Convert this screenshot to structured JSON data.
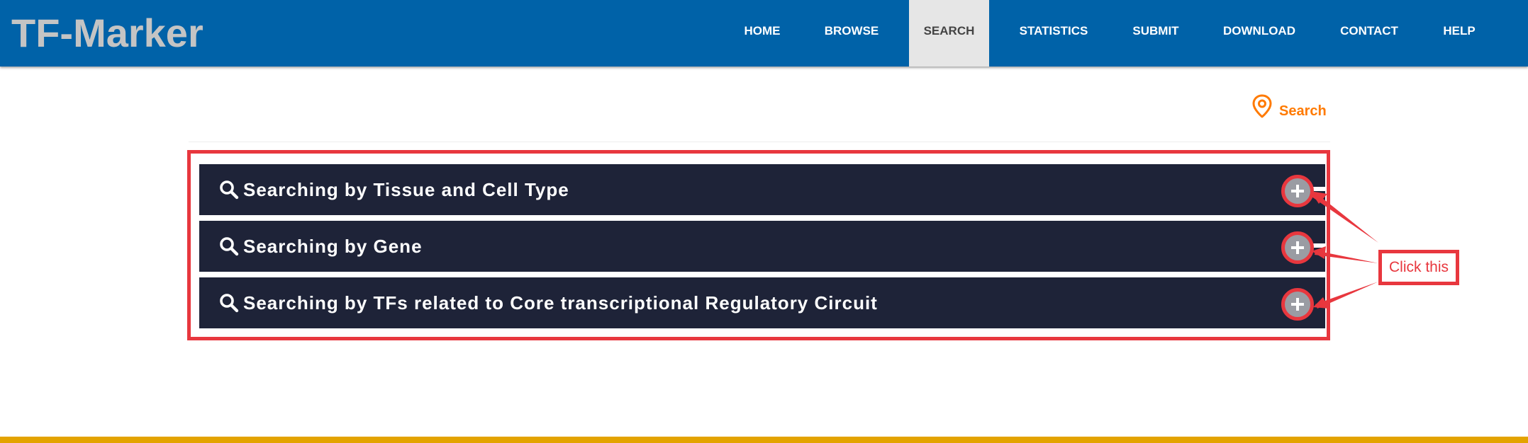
{
  "app": {
    "brand": "TF-Marker"
  },
  "nav": {
    "items": [
      {
        "label": "HOME",
        "active": false
      },
      {
        "label": "BROWSE",
        "active": false
      },
      {
        "label": "SEARCH",
        "active": true
      },
      {
        "label": "STATISTICS",
        "active": false
      },
      {
        "label": "SUBMIT",
        "active": false
      },
      {
        "label": "DOWNLOAD",
        "active": false
      },
      {
        "label": "CONTACT",
        "active": false
      },
      {
        "label": "HELP",
        "active": false
      }
    ]
  },
  "breadcrumb": {
    "icon": "location-pin-icon",
    "label": "Search"
  },
  "panels": [
    {
      "icon": "search-icon",
      "title": "Searching by Tissue and Cell Type",
      "toggle_icon": "plus-circle-icon"
    },
    {
      "icon": "search-icon",
      "title": "Searching by Gene",
      "toggle_icon": "plus-circle-icon"
    },
    {
      "icon": "search-icon",
      "title": "Searching by TFs related to Core transcriptional Regulatory Circuit",
      "toggle_icon": "plus-circle-icon"
    }
  ],
  "annotation": {
    "callout_text": "Click this"
  },
  "colors": {
    "navbar": "#0062a8",
    "brand_text": "#c4c4c4",
    "active_tab": "#e6e6e6",
    "breadcrumb_accent": "#ff7a00",
    "panel_bg": "#1e2338",
    "annotation_red": "#e8373e",
    "footer_accent": "#e3a300"
  }
}
